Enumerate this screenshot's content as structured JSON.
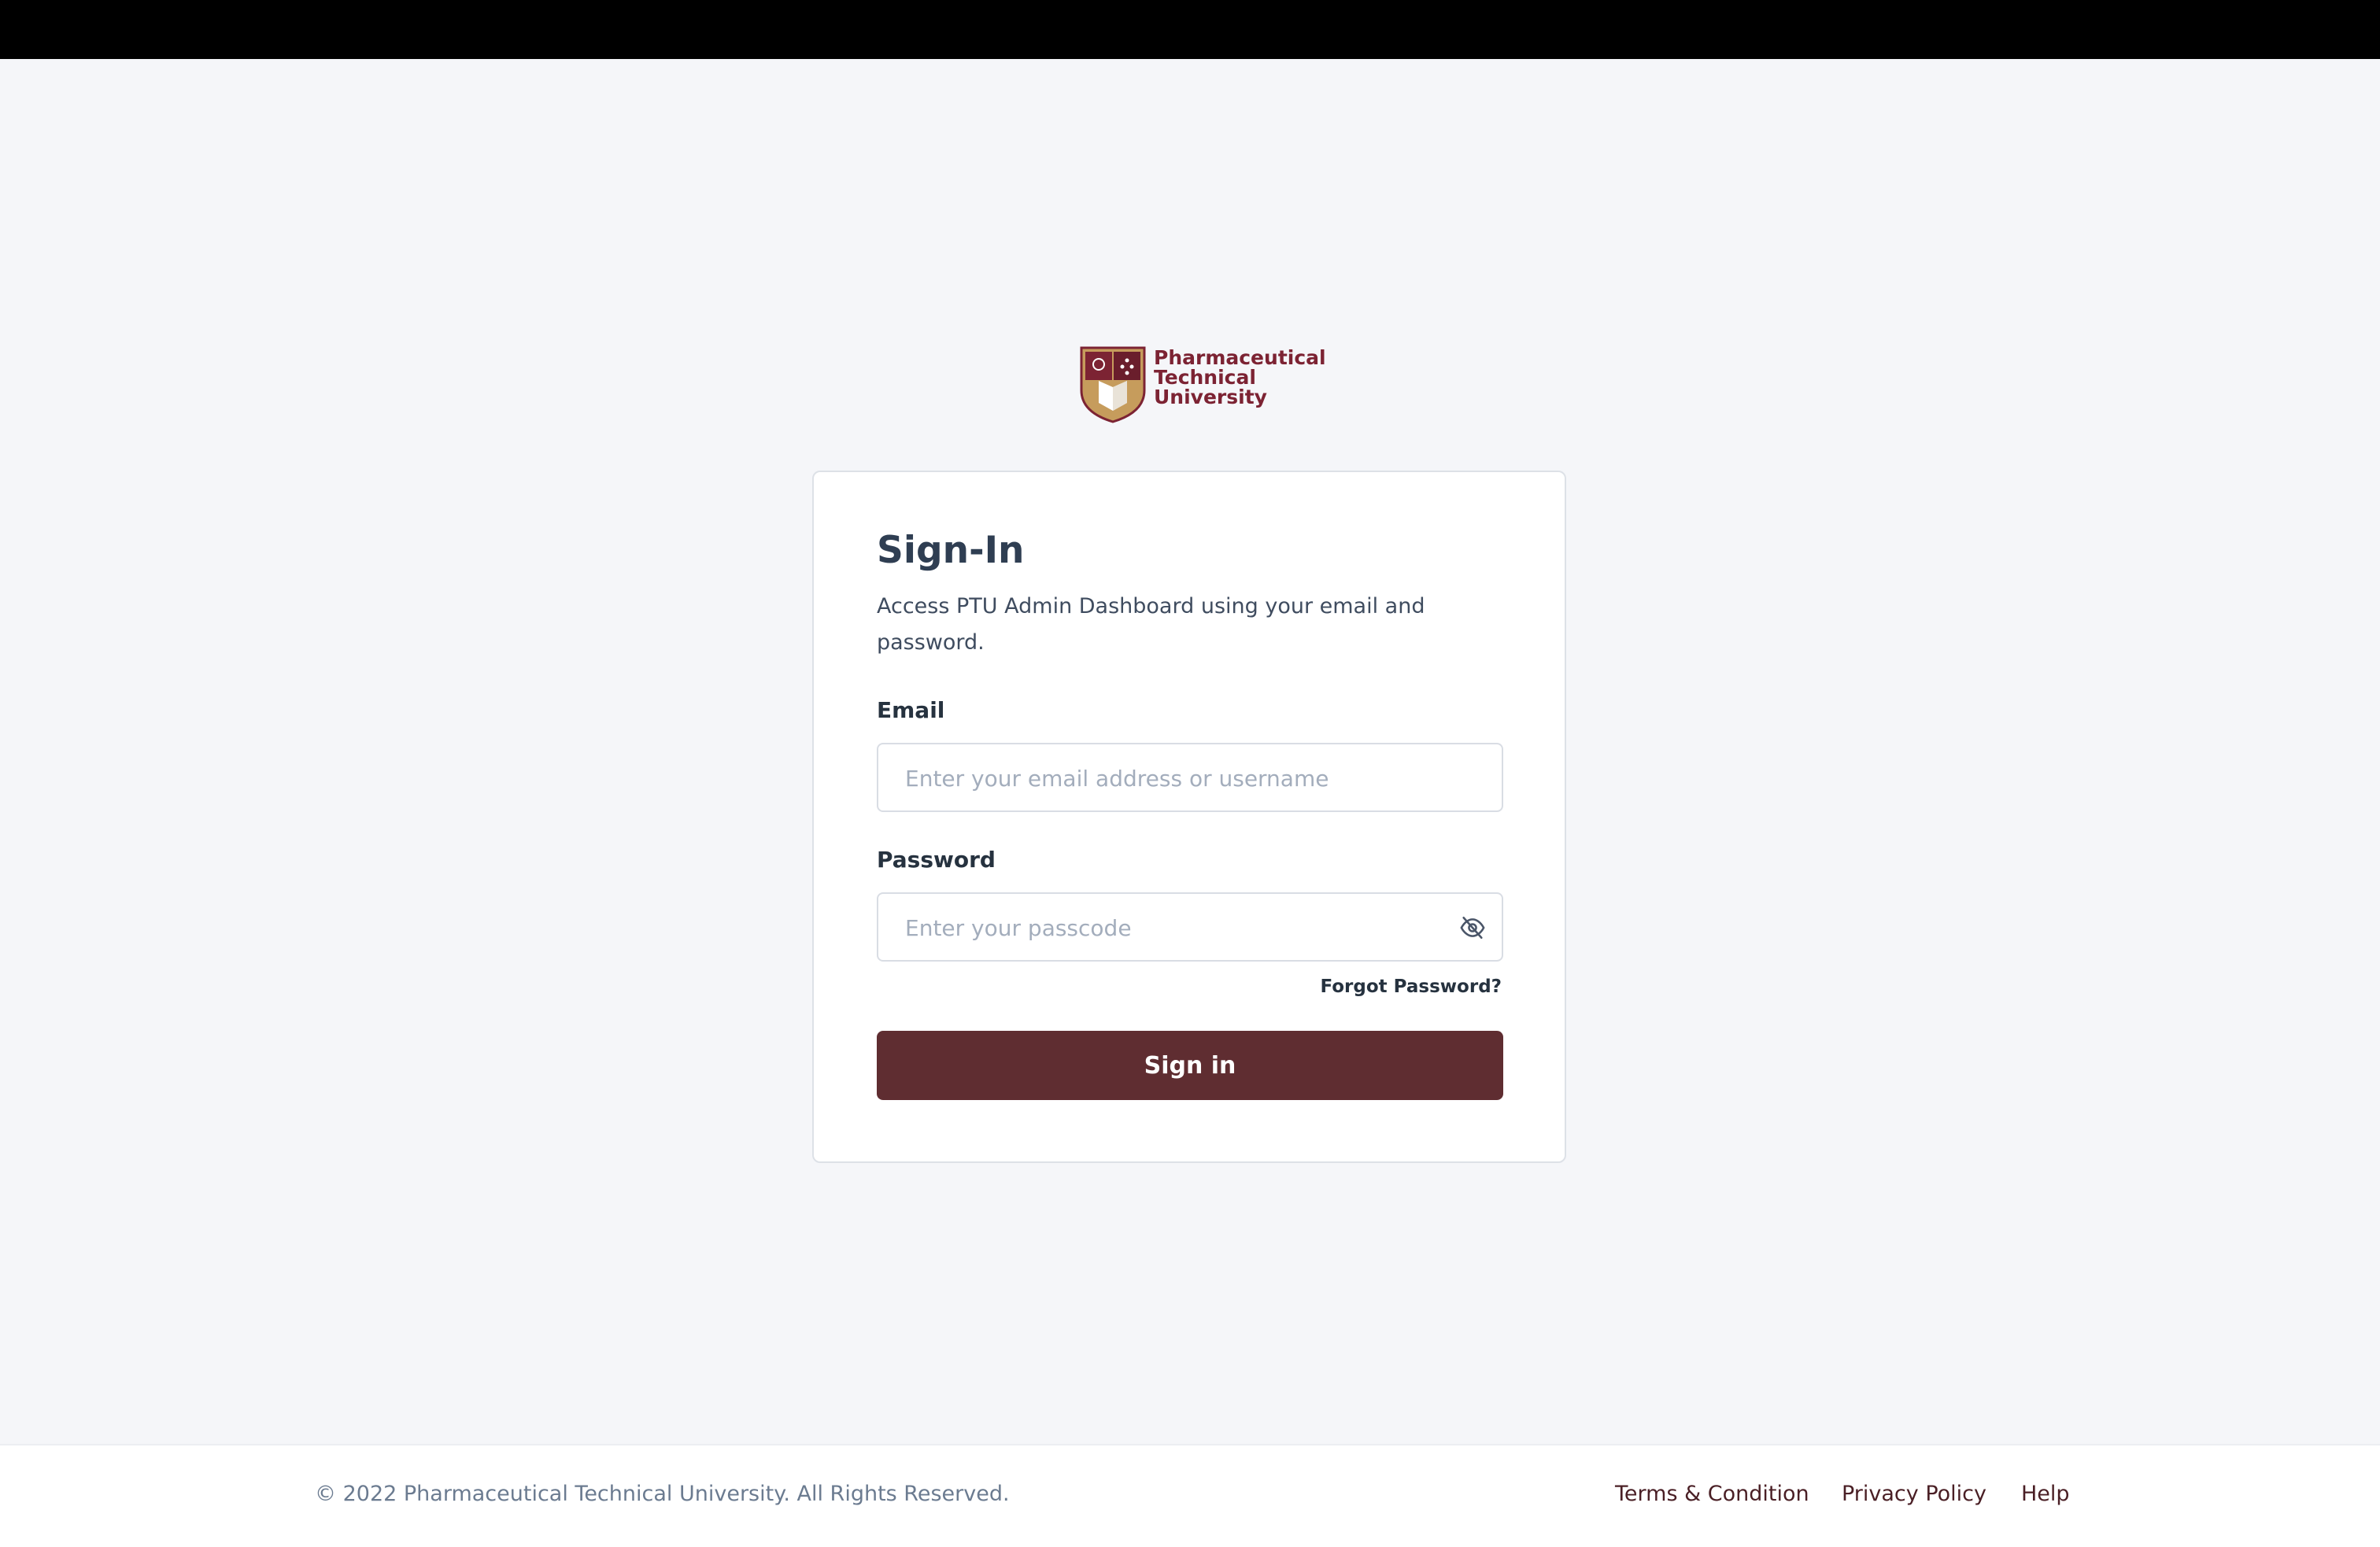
{
  "brand": {
    "line1": "Pharmaceutical",
    "line2": "Technical",
    "line3": "University",
    "colors": {
      "primary": "#7c2333",
      "gold": "#c69c5c"
    }
  },
  "signin": {
    "title": "Sign-In",
    "subtitle": "Access PTU Admin Dashboard using your email and password.",
    "email_label": "Email",
    "email_placeholder": "Enter your email address or username",
    "email_value": "",
    "password_label": "Password",
    "password_placeholder": "Enter your passcode",
    "password_value": "",
    "toggle_icon": "eye-off-icon",
    "forgot_label": "Forgot Password?",
    "submit_label": "Sign in",
    "button_color": "#5f2d31"
  },
  "footer": {
    "copyright": "© 2022 Pharmaceutical Technical University. All Rights Reserved.",
    "links": [
      "Terms & Condition",
      "Privacy Policy",
      "Help"
    ]
  }
}
